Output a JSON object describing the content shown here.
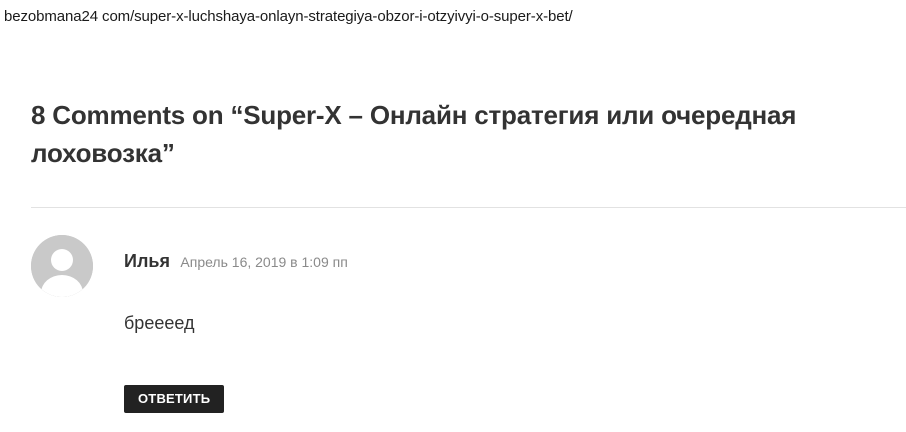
{
  "url": "bezobmana24 com/super-x-luchshaya-onlayn-strategiya-obzor-i-otzyivyi-o-super-x-bet/",
  "comments_section": {
    "title": "8 Comments on “Super-X – Онлайн стратегия или очередная лоховозка”"
  },
  "comment": {
    "author": "Илья",
    "date": "Апрель 16, 2019 в 1:09 пп",
    "text": "бреееед",
    "avatar_icon": "default-user-avatar-icon",
    "reply_label": "ОТВЕТИТЬ"
  },
  "colors": {
    "reply_button_bg": "#222222",
    "avatar_bg": "#c9c9c9",
    "meta_text": "#8a8a8a"
  }
}
